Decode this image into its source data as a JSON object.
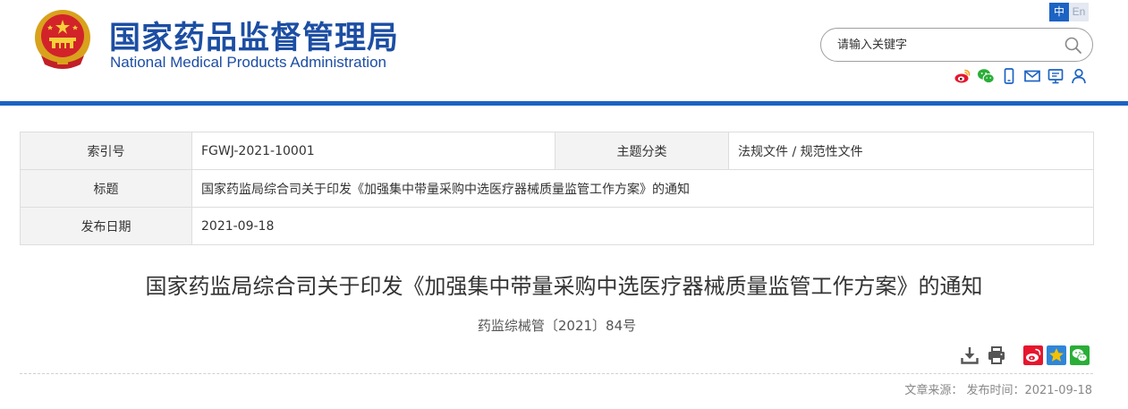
{
  "header": {
    "title_cn": "国家药品监督管理局",
    "title_en": "National Medical Products Administration",
    "lang_zh": "中",
    "lang_en": "En",
    "search_placeholder": "请输入关键字",
    "icons": [
      "weibo-icon",
      "wechat-icon",
      "mobile-icon",
      "mail-icon",
      "message-board-icon",
      "user-icon"
    ]
  },
  "meta": {
    "index_label": "索引号",
    "index_value": "FGWJ-2021-10001",
    "category_label": "主题分类",
    "category_value": "法规文件 / 规范性文件",
    "title_label": "标题",
    "title_value": "国家药监局综合司关于印发《加强集中带量采购中选医疗器械质量监管工作方案》的通知",
    "date_label": "发布日期",
    "date_value": "2021-09-18"
  },
  "article": {
    "title": "国家药监局综合司关于印发《加强集中带量采购中选医疗器械质量监管工作方案》的通知",
    "doc_number": "药监综械管〔2021〕84号",
    "source_line": "文章来源：  发布时间：2021-09-18"
  },
  "colors": {
    "brand_blue": "#1c4ea3",
    "rule_blue": "#1c63c3",
    "weibo_red": "#e6162d",
    "wechat_green": "#2aae37",
    "star_gold": "#f5c100"
  }
}
